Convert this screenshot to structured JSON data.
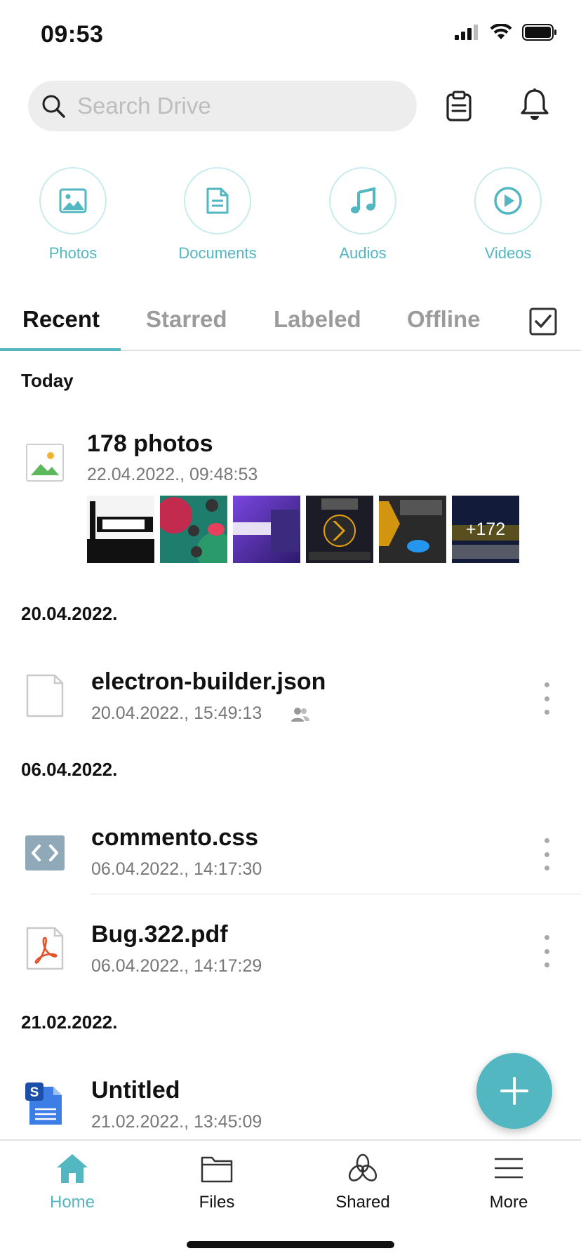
{
  "status_bar": {
    "time": "09:53"
  },
  "search": {
    "placeholder": "Search Drive"
  },
  "categories": [
    {
      "label": "Photos",
      "icon": "image-icon"
    },
    {
      "label": "Documents",
      "icon": "document-icon"
    },
    {
      "label": "Audios",
      "icon": "music-note-icon"
    },
    {
      "label": "Videos",
      "icon": "play-icon"
    }
  ],
  "tabs": [
    {
      "label": "Recent",
      "active": true
    },
    {
      "label": "Starred",
      "active": false
    },
    {
      "label": "Labeled",
      "active": false
    },
    {
      "label": "Offline",
      "active": false
    }
  ],
  "sections": [
    {
      "header": "Today",
      "items": [
        {
          "name": "178 photos",
          "date": "22.04.2022., 09:48:53",
          "thumb_more": "+172"
        }
      ]
    },
    {
      "header": "20.04.2022.",
      "items": [
        {
          "name": "electron-builder.json",
          "date": "20.04.2022., 15:49:13",
          "shared": true
        }
      ]
    },
    {
      "header": "06.04.2022.",
      "items": [
        {
          "name": "commento.css",
          "date": "06.04.2022., 14:17:30"
        },
        {
          "name": "Bug.322.pdf",
          "date": "06.04.2022., 14:17:29"
        }
      ]
    },
    {
      "header": "21.02.2022.",
      "items": [
        {
          "name": "Untitled",
          "date": "21.02.2022., 13:45:09"
        }
      ]
    }
  ],
  "bottom_nav": [
    {
      "label": "Home",
      "active": true
    },
    {
      "label": "Files",
      "active": false
    },
    {
      "label": "Shared",
      "active": false
    },
    {
      "label": "More",
      "active": false
    }
  ],
  "colors": {
    "accent": "#52b7c1",
    "search_bg": "#ededed"
  }
}
